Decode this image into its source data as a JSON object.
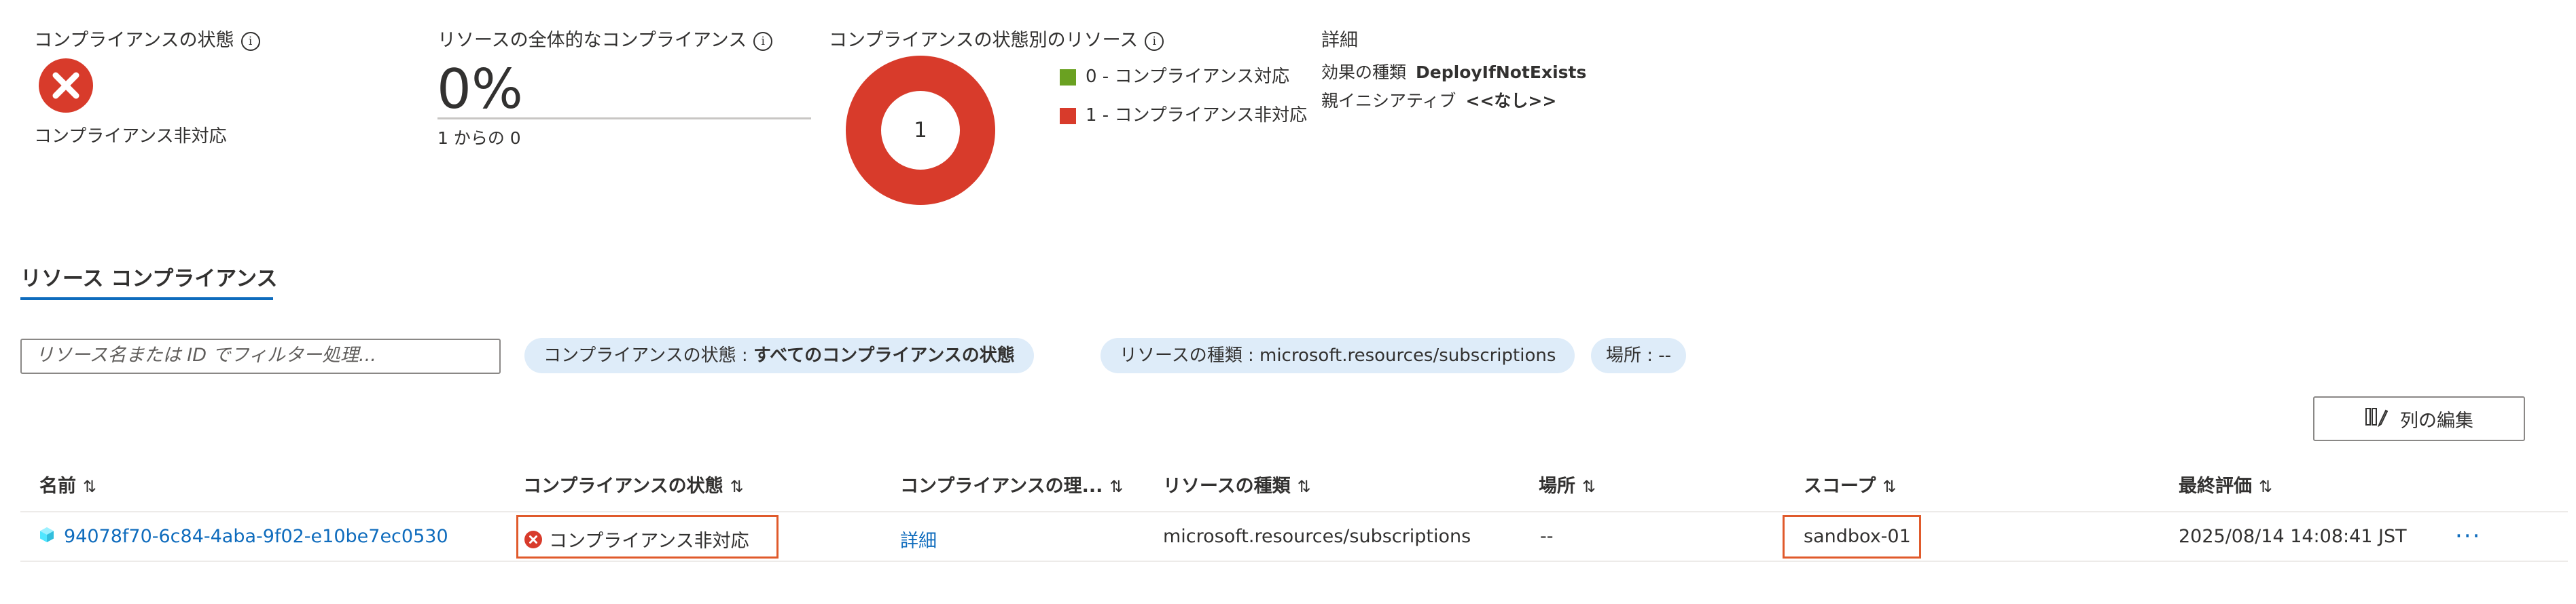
{
  "summary": {
    "compliance_state": {
      "label": "コンプライアンスの状態",
      "info": "i",
      "status": "コンプライアンス非対応"
    },
    "overall": {
      "label": "リソースの全体的なコンプライアンス",
      "info": "i",
      "percent": "0%",
      "sub": "1 からの 0",
      "progress_fraction": 0
    },
    "by_state": {
      "label": "コンプライアンスの状態別のリソース",
      "info": "i",
      "center_value": "1",
      "legend": [
        {
          "text": "0 - コンプライアンス対応",
          "color": "#6aa121"
        },
        {
          "text": "1 - コンプライアンス非対応",
          "color": "#d83b2b"
        }
      ]
    },
    "details": {
      "title": "詳細",
      "effect_label": "効果の種類",
      "effect_value": "DeployIfNotExists",
      "parent_label": "親イニシアティブ",
      "parent_value": "<<なし>>"
    }
  },
  "tab": {
    "label": "リソース コンプライアンス"
  },
  "filters": {
    "search_placeholder": "リソース名または ID でフィルター処理...",
    "pills": [
      {
        "key": "コンプライアンスの状態 : ",
        "value": "すべてのコンプライアンスの状態"
      },
      {
        "key": "リソースの種類 : ",
        "value": "microsoft.resources/subscriptions"
      },
      {
        "key": "場所 : ",
        "value": "--"
      }
    ]
  },
  "toolbar": {
    "edit_columns_label": "列の編集"
  },
  "table": {
    "sort_glyph": "⇅",
    "headers": {
      "name": "名前",
      "state": "コンプライアンスの状態",
      "reason": "コンプライアンスの理...",
      "type": "リソースの種類",
      "location": "場所",
      "scope": "スコープ",
      "last_eval": "最終評価"
    },
    "rows": [
      {
        "name": "94078f70-6c84-4aba-9f02-e10be7ec0530",
        "state": "コンプライアンス非対応",
        "reason": "詳細",
        "type": "microsoft.resources/subscriptions",
        "location": "--",
        "scope": "sandbox-01",
        "last_eval": "2025/08/14 14:08:41 JST",
        "more": "···"
      }
    ]
  },
  "colors": {
    "accent": "#0f6cbd",
    "error": "#d83b2b",
    "success": "#6aa121",
    "highlight_border": "#e05a2b"
  }
}
